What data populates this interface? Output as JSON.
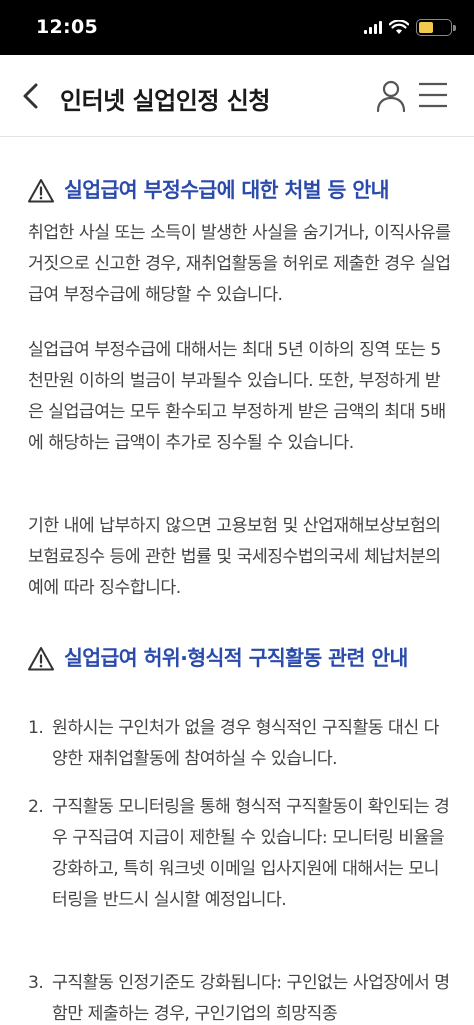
{
  "status_bar": {
    "time": "12:05",
    "battery_level": 0.45,
    "battery_color": "#f2c94c"
  },
  "header": {
    "back_icon": "chevron-left-icon",
    "title": "인터넷 실업인정 신청",
    "user_icon": "user-icon",
    "menu_icon": "hamburger-menu-icon"
  },
  "accent_color": "#2a4bac",
  "sections": [
    {
      "icon": "warning-icon",
      "title": "실업급여 부정수급에 대한 처벌 등 안내",
      "paragraphs": [
        "취업한 사실 또는 소득이 발생한 사실을 숨기거나, 이직사유를 거짓으로 신고한 경우, 재취업활동을 허위로 제출한 경우 실업급여 부정수급에 해당할 수 있습니다.",
        "실업급여 부정수급에 대해서는 최대 5년 이하의 징역 또는 5천만원 이하의 벌금이 부과될수 있습니다. 또한, 부정하게 받은 실업급여는 모두 환수되고 부정하게 받은 금액의 최대 5배에 해당하는 급액이 추가로 징수될 수 있습니다.",
        "기한 내에 납부하지 않으면 고용보험 및 산업재해보상보험의 보험료징수 등에 관한 법률 및 국세징수법의국세 체납처분의 예에 따라 징수합니다."
      ]
    },
    {
      "icon": "warning-icon",
      "title": "실업급여 허위·형식적 구직활동 관련 안내",
      "items": [
        {
          "num": "1.",
          "text": "원하시는 구인처가 없을 경우 형식적인 구직활동 대신 다양한 재취업활동에 참여하실 수 있습니다."
        },
        {
          "num": "2.",
          "text": "구직활동 모니터링을 통해 형식적 구직활동이 확인되는 경우 구직급여 지급이 제한될 수 있습니다: 모니터링 비율을 강화하고, 특히 워크넷 이메일 입사지원에 대해서는 모니터링을 반드시 실시할 예정입니다."
        },
        {
          "num": "3.",
          "text": "구직활동 인정기준도 강화됩니다: 구인없는 사업장에서 명함만 제출하는 경우, 구인기업의 희망직종"
        }
      ]
    }
  ]
}
